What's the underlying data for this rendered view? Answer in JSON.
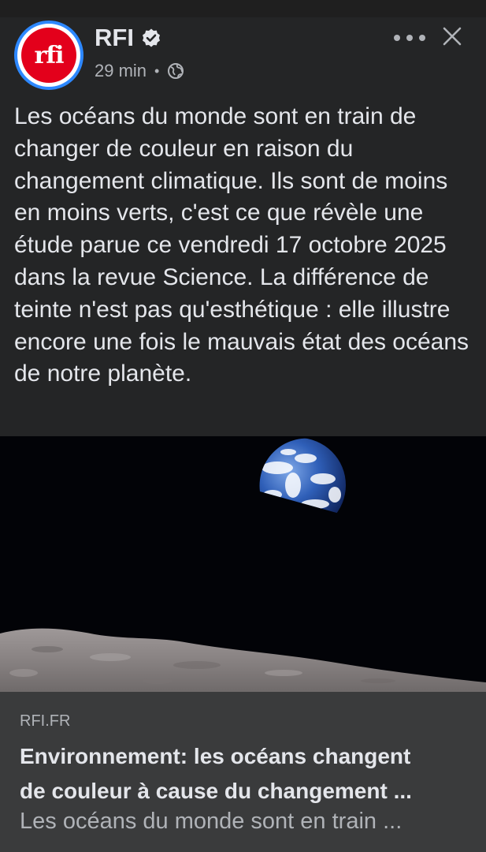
{
  "post": {
    "author": "RFI",
    "avatar_label": "rfi",
    "verified_icon": "verified-check-icon",
    "time": "29 min",
    "separator": "•",
    "audience_icon": "globe-icon",
    "text": "Les océans du monde sont en train de changer de couleur en raison du changement climatique. Ils sont de moins en moins verts, c'est ce que révèle une étude parue ce vendredi 17 octobre 2025 dans la revue Science. La différence de teinte n'est pas qu'esthétique : elle illustre encore une fois le mauvais état des océans de notre planète."
  },
  "actions": {
    "more_icon": "more-options-icon",
    "close_icon": "close-icon"
  },
  "link_card": {
    "domain": "RFI.FR",
    "title_line1": "Environnement: les océans changent",
    "title_line2": "de couleur à cause du changement ...",
    "subtitle": "Les océans du monde sont en train ..."
  },
  "colors": {
    "background": "#242526",
    "card": "#3a3b3c",
    "brand_red": "#e3001b",
    "ring_blue": "#2d88ff"
  }
}
